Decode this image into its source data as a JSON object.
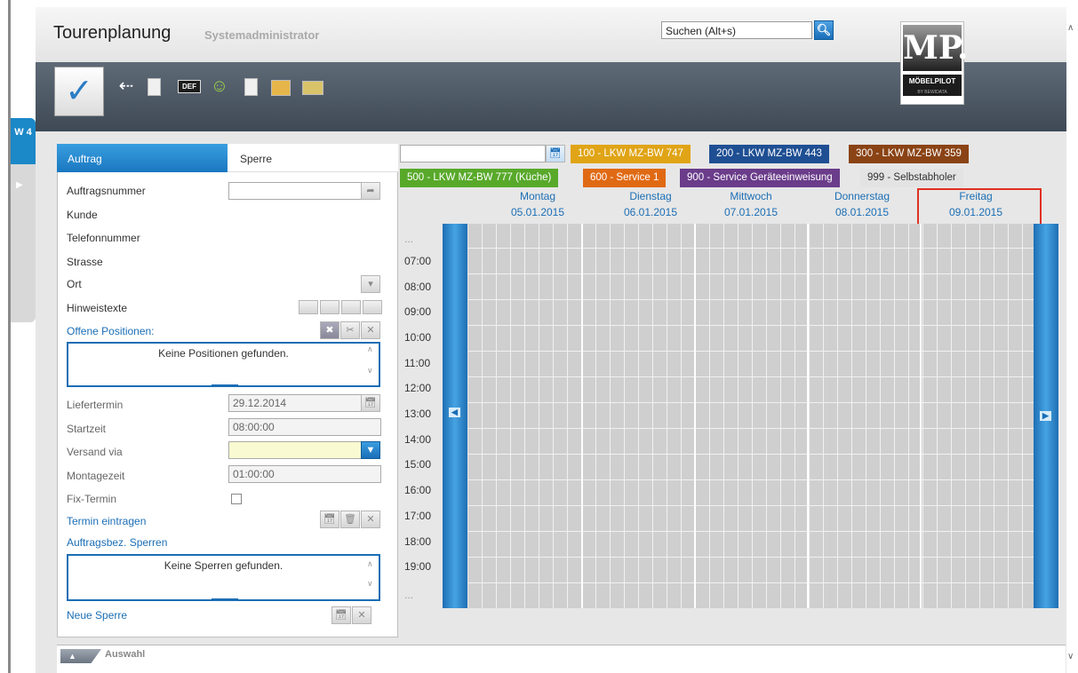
{
  "header": {
    "title": "Tourenplanung",
    "subtitle": "Systemadministrator",
    "search_value": "Suchen (Alt+s)"
  },
  "logo": {
    "letters": "MP.",
    "name": "MÖBELPILOT",
    "byline": "BY BEWIDATA"
  },
  "side_tab": {
    "label": "W 4"
  },
  "left_panel": {
    "tabs": [
      "Auftrag",
      "Sperre"
    ],
    "fields": {
      "auftragsnummer": "Auftragsnummer",
      "kunde": "Kunde",
      "telefon": "Telefonnummer",
      "strasse": "Strasse",
      "ort": "Ort",
      "hinweistexte": "Hinweistexte",
      "offene_positionen": "Offene Positionen:",
      "keine_positionen": "Keine Positionen gefunden.",
      "liefertermin": "Liefertermin",
      "liefertermin_value": "29.12.2014",
      "startzeit": "Startzeit",
      "startzeit_value": "08:00:00",
      "versand_via": "Versand via",
      "montagezeit": "Montagezeit",
      "montagezeit_value": "01:00:00",
      "fix_termin": "Fix-Termin",
      "termin_eintragen": "Termin eintragen",
      "auftragsbez_sperren": "Auftragsbez. Sperren",
      "keine_sperren": "Keine Sperren gefunden.",
      "neue_sperre": "Neue Sperre"
    }
  },
  "tours": [
    {
      "label": "100 - LKW MZ-BW 747",
      "color": "#e0a416"
    },
    {
      "label": "200 - LKW MZ-BW 443",
      "color": "#1f4f93"
    },
    {
      "label": "300 - LKW MZ-BW 359",
      "color": "#8a4314"
    },
    {
      "label": "500 - LKW MZ-BW 777 (Küche)",
      "color": "#58a92a"
    },
    {
      "label": "600 - Service 1",
      "color": "#e06a14"
    },
    {
      "label": "900 - Service Geräteeinweisung",
      "color": "#6a3c8a"
    },
    {
      "label": "999 - Selbstabholer",
      "color": "#e3e3e3"
    }
  ],
  "days": [
    {
      "name": "Montag",
      "date": "05.01.2015"
    },
    {
      "name": "Dienstag",
      "date": "06.01.2015"
    },
    {
      "name": "Mittwoch",
      "date": "07.01.2015"
    },
    {
      "name": "Donnerstag",
      "date": "08.01.2015"
    },
    {
      "name": "Freitag",
      "date": "09.01.2015"
    }
  ],
  "times": [
    "...",
    "07:00",
    "08:00",
    "09:00",
    "10:00",
    "11:00",
    "12:00",
    "13:00",
    "14:00",
    "15:00",
    "16:00",
    "17:00",
    "18:00",
    "19:00",
    "..."
  ],
  "bottom": {
    "auswahl": "Auswahl"
  }
}
